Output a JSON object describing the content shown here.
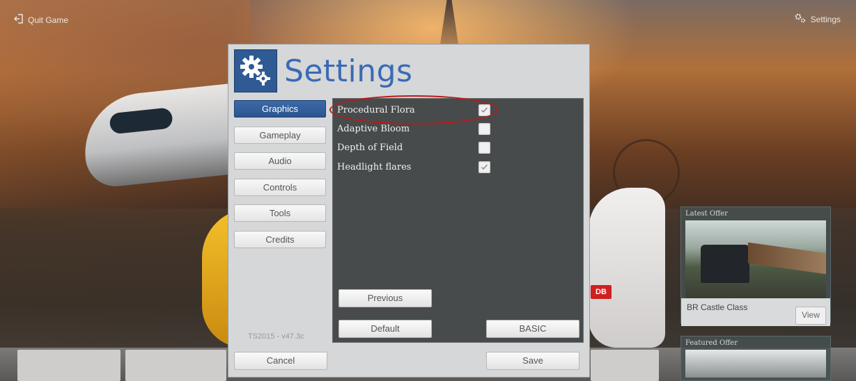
{
  "topbar": {
    "quit_label": "Quit Game",
    "settings_label": "Settings"
  },
  "dialog": {
    "title": "Settings",
    "tabs": [
      {
        "label": "Graphics",
        "active": true
      },
      {
        "label": "Gameplay",
        "active": false
      },
      {
        "label": "Audio",
        "active": false
      },
      {
        "label": "Controls",
        "active": false
      },
      {
        "label": "Tools",
        "active": false
      },
      {
        "label": "Credits",
        "active": false
      }
    ],
    "options": [
      {
        "label": "Procedural Flora",
        "checked": true
      },
      {
        "label": "Adaptive Bloom",
        "checked": false
      },
      {
        "label": "Depth of Field",
        "checked": false
      },
      {
        "label": "Headlight flares",
        "checked": true
      }
    ],
    "previous_label": "Previous",
    "default_label": "Default",
    "basic_label": "BASIC",
    "version": "TS2015 - v47.3c",
    "cancel_label": "Cancel",
    "save_label": "Save"
  },
  "offers": {
    "latest_label": "Latest Offer",
    "latest_name": "BR Castle Class",
    "view_label": "View",
    "featured_label": "Featured Offer"
  },
  "colors": {
    "accent": "#2f5a93",
    "title": "#3a6ab5",
    "panel": "#474b4b",
    "highlight": "#c01818"
  }
}
